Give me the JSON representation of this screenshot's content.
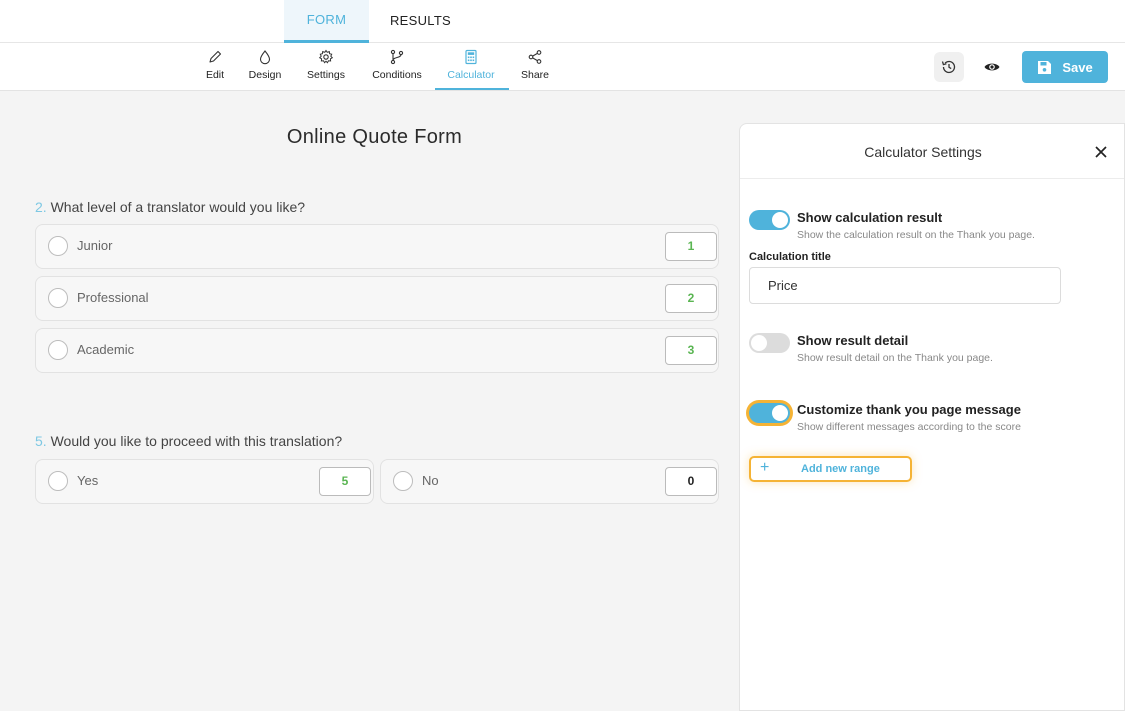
{
  "top_tabs": {
    "form": "FORM",
    "results": "RESULTS"
  },
  "toolbar": {
    "edit": "Edit",
    "design": "Design",
    "settings": "Settings",
    "conditions": "Conditions",
    "calculator": "Calculator",
    "share": "Share",
    "save": "Save"
  },
  "form": {
    "title": "Online Quote Form",
    "questions": [
      {
        "number": "2.",
        "text": "What level of a translator would you like?",
        "options": [
          {
            "label": "Junior",
            "score": "1"
          },
          {
            "label": "Professional",
            "score": "2"
          },
          {
            "label": "Academic",
            "score": "3"
          }
        ]
      },
      {
        "number": "5.",
        "text": "Would you like to proceed with this translation?",
        "options": [
          {
            "label": "Yes",
            "score": "5"
          },
          {
            "label": "No",
            "score": "0"
          }
        ]
      }
    ]
  },
  "panel": {
    "title": "Calculator Settings",
    "settings": [
      {
        "title": "Show calculation result",
        "desc": "Show the calculation result on the Thank you page.",
        "enabled": true
      },
      {
        "title": "Show result detail",
        "desc": "Show result detail on the Thank you page.",
        "enabled": false
      },
      {
        "title": "Customize thank you page message",
        "desc": "Show different messages according to the score",
        "enabled": true
      }
    ],
    "calc_title_label": "Calculation title",
    "calc_title_value": "Price",
    "add_range": "Add new range"
  },
  "colors": {
    "accent": "#4fb3db",
    "focus": "#f5b335",
    "score_green": "#5ab552"
  },
  "icons": [
    "pencil-icon",
    "drop-icon",
    "gear-icon",
    "branch-icon",
    "calculator-icon",
    "share-icon",
    "history-icon",
    "eye-icon",
    "floppy-icon",
    "close-icon",
    "plus-icon"
  ]
}
